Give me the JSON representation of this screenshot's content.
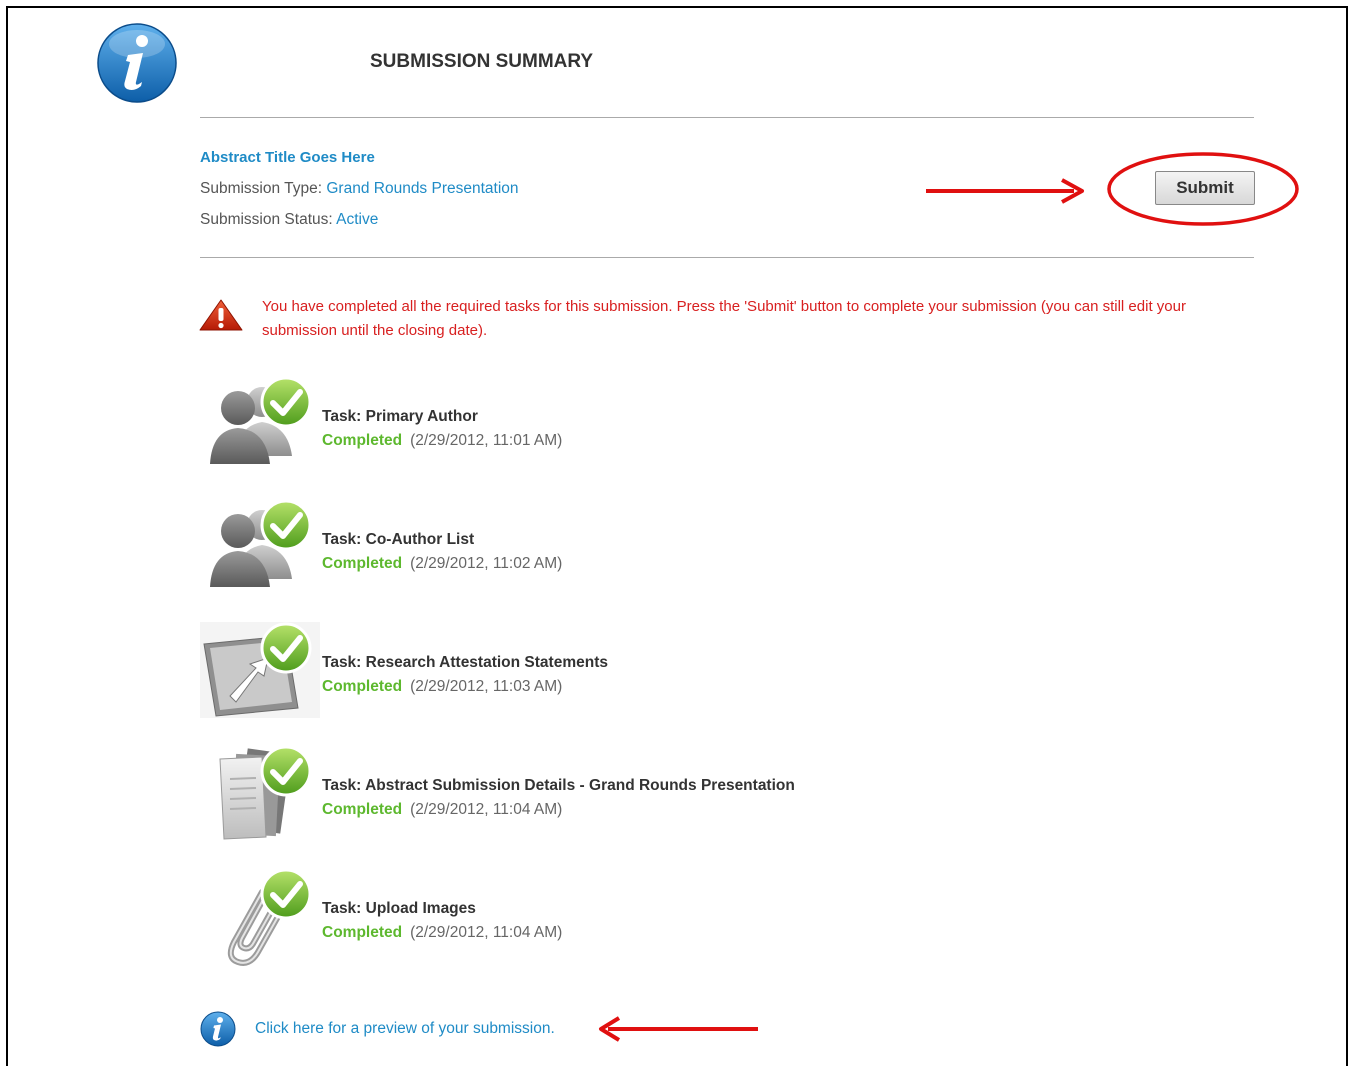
{
  "header": {
    "title": "SUBMISSION SUMMARY",
    "logo_icon": "info-icon"
  },
  "summary": {
    "abstract_title": "Abstract Title Goes Here",
    "type_label": "Submission Type:",
    "type_value": "Grand Rounds Presentation",
    "status_label": "Submission Status:",
    "status_value": "Active",
    "submit_label": "Submit"
  },
  "alert": {
    "icon": "warning-icon",
    "message": "You have completed all the required tasks for this submission. Press the 'Submit' button to complete your submission (you can still edit your submission until the closing date)."
  },
  "tasks": [
    {
      "name": "Task: Primary Author",
      "status": "Completed",
      "time": "(2/29/2012, 11:01 AM)",
      "icon": "author-icon"
    },
    {
      "name": "Task: Co-Author List",
      "status": "Completed",
      "time": "(2/29/2012, 11:02 AM)",
      "icon": "coauthor-icon"
    },
    {
      "name": "Task: Research Attestation Statements",
      "status": "Completed",
      "time": "(2/29/2012, 11:03 AM)",
      "icon": "attestation-icon"
    },
    {
      "name": "Task: Abstract Submission Details - Grand Rounds Presentation",
      "status": "Completed",
      "time": "(2/29/2012, 11:04 AM)",
      "icon": "documents-icon"
    },
    {
      "name": "Task: Upload Images",
      "status": "Completed",
      "time": "(2/29/2012, 11:04 AM)",
      "icon": "paperclip-icon"
    }
  ],
  "preview": {
    "label": "Click here for a preview of your submission.",
    "icon": "info-icon"
  },
  "colors": {
    "link": "#1f8bc6",
    "alert": "#d82020",
    "completed": "#5db82e",
    "annotation": "#e01010"
  }
}
